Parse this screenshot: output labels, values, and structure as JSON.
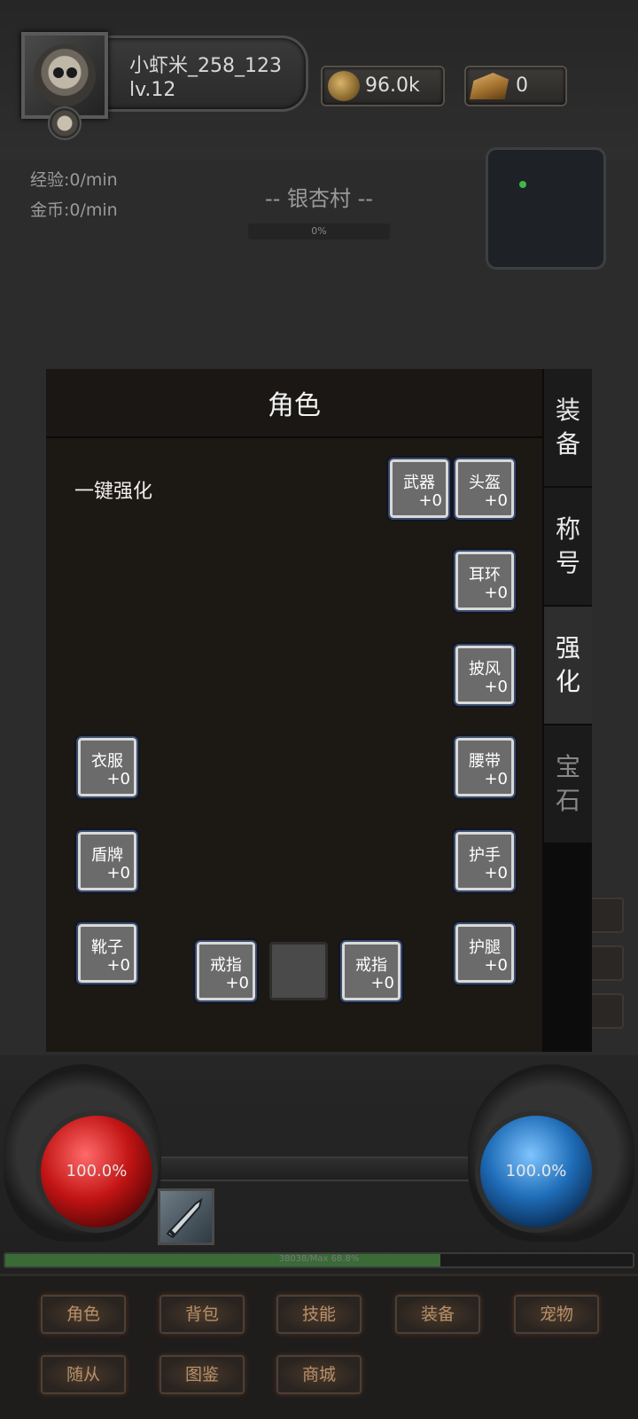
{
  "player": {
    "name": "小虾米_258_123",
    "level": "lv.12"
  },
  "resources": {
    "gold": "96.0k",
    "ingot": "0"
  },
  "rates": {
    "exp": "经验:0/min",
    "gold": "金币:0/min"
  },
  "location": {
    "name": "-- 银杏村 --",
    "progress": "0%"
  },
  "panel": {
    "title": "角色",
    "one_key_label": "一键强化",
    "slots": {
      "weapon": {
        "name": "武器",
        "level": "+0"
      },
      "helmet": {
        "name": "头盔",
        "level": "+0"
      },
      "earring": {
        "name": "耳环",
        "level": "+0"
      },
      "cloak": {
        "name": "披风",
        "level": "+0"
      },
      "clothes": {
        "name": "衣服",
        "level": "+0"
      },
      "belt": {
        "name": "腰带",
        "level": "+0"
      },
      "shield": {
        "name": "盾牌",
        "level": "+0"
      },
      "gloves": {
        "name": "护手",
        "level": "+0"
      },
      "boots": {
        "name": "靴子",
        "level": "+0"
      },
      "leggings": {
        "name": "护腿",
        "level": "+0"
      },
      "ring_left": {
        "name": "戒指",
        "level": "+0"
      },
      "ring_right": {
        "name": "戒指",
        "level": "+0"
      }
    }
  },
  "side_tabs": [
    {
      "label": "装\n备"
    },
    {
      "label": "称\n号"
    },
    {
      "label": "强\n化",
      "active": true
    },
    {
      "label": "宝\n石"
    }
  ],
  "hud": {
    "hp": "100.0%",
    "mp": "100.0%",
    "exp_text": "38038/Max     68.8%",
    "exp_fraction": 0.69
  },
  "menu": {
    "row1": [
      "角色",
      "背包",
      "技能",
      "装备",
      "宠物"
    ],
    "row2": [
      "随从",
      "图鉴",
      "商城"
    ]
  }
}
